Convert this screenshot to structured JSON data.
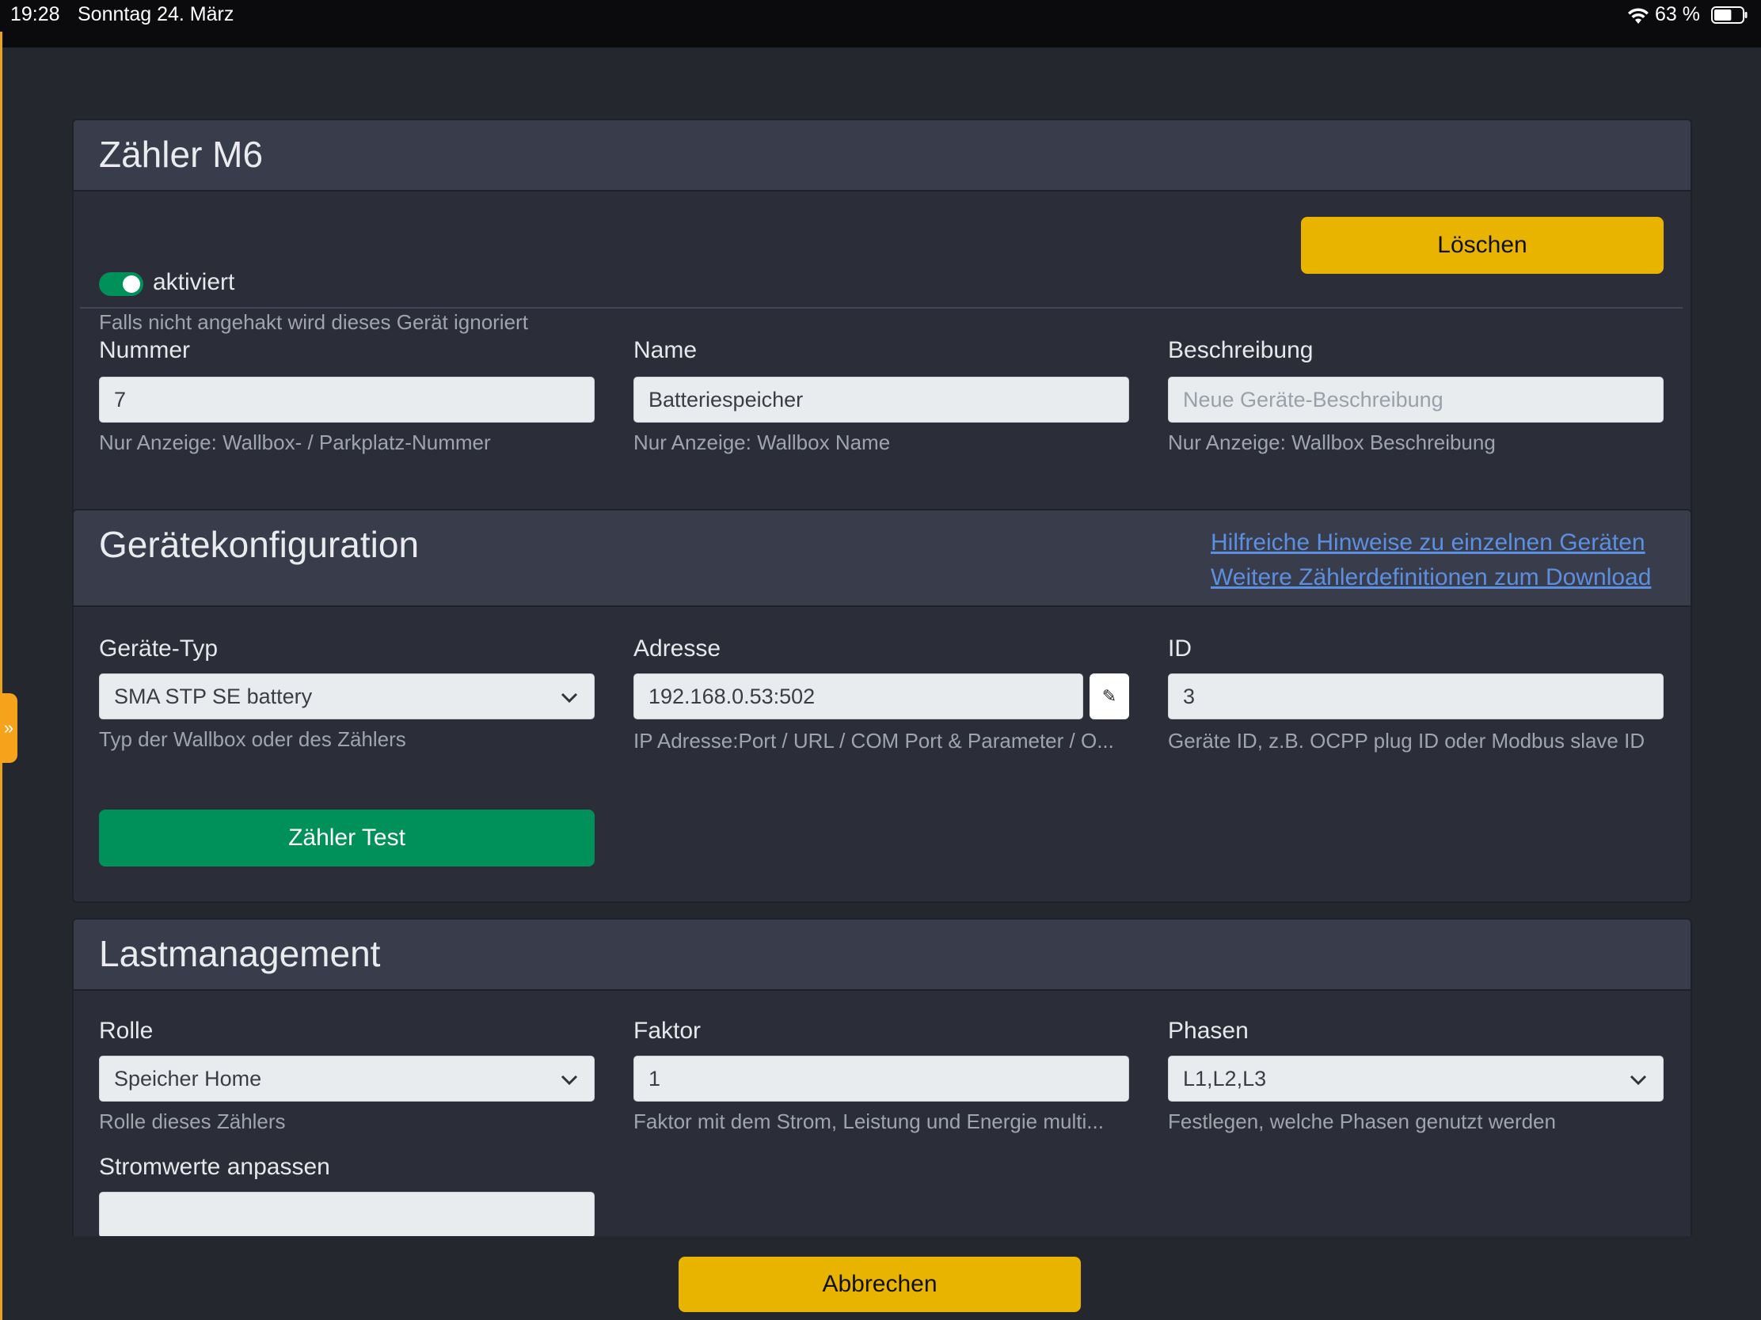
{
  "status_bar": {
    "time": "19:28",
    "date": "Sonntag 24. März",
    "battery_percent": "63 %",
    "battery_level": 0.63,
    "icons": [
      "wifi-icon",
      "battery-icon"
    ]
  },
  "colors": {
    "accent_yellow": "#e8b400",
    "accent_green": "#00905a",
    "link": "#5c8fe0",
    "panel": "#2b2d39",
    "header": "#393c4a"
  },
  "side_tab": {
    "glyph": "»",
    "icon": "chevron-double-right-icon"
  },
  "meter_card": {
    "title": "Zähler M6",
    "enabled_label": "aktiviert",
    "enabled": true,
    "enabled_help": "Falls nicht angehakt wird dieses Gerät ignoriert",
    "delete_label": "Löschen",
    "fields": {
      "number": {
        "label": "Nummer",
        "value": "7",
        "help": "Nur Anzeige: Wallbox- / Parkplatz-Nummer"
      },
      "name": {
        "label": "Name",
        "value": "Batteriespeicher",
        "help": "Nur Anzeige: Wallbox Name"
      },
      "description": {
        "label": "Beschreibung",
        "placeholder": "Neue Geräte-Beschreibung",
        "value": "",
        "help": "Nur Anzeige: Wallbox Beschreibung"
      }
    }
  },
  "device_config": {
    "title": "Gerätekonfiguration",
    "link_hints": "Hilfreiche Hinweise zu einzelnen Geräten",
    "link_download": "Weitere Zählerdefinitionen zum Download",
    "device_type": {
      "label": "Geräte-Typ",
      "selected": "SMA STP SE battery",
      "help": "Typ der Wallbox oder des Zählers"
    },
    "address": {
      "label": "Adresse",
      "value": "192.168.0.53:502",
      "help": "IP Adresse:Port / URL / COM Port & Parameter / O...",
      "edit_glyph": "✎"
    },
    "id": {
      "label": "ID",
      "value": "3",
      "help": "Geräte ID, z.B. OCPP plug ID oder Modbus slave ID"
    },
    "test_button": "Zähler Test"
  },
  "load_management": {
    "title": "Lastmanagement",
    "role": {
      "label": "Rolle",
      "selected": "Speicher Home",
      "help": "Rolle dieses Zählers"
    },
    "factor": {
      "label": "Faktor",
      "value": "1",
      "help": "Faktor mit dem Strom, Leistung und Energie multi..."
    },
    "phases": {
      "label": "Phasen",
      "selected": "L1,L2,L3",
      "help": "Festlegen, welche Phasen genutzt werden"
    },
    "adjust_current": {
      "label": "Stromwerte anpassen",
      "value": ""
    }
  },
  "footer": {
    "cancel_label": "Abbrechen"
  }
}
